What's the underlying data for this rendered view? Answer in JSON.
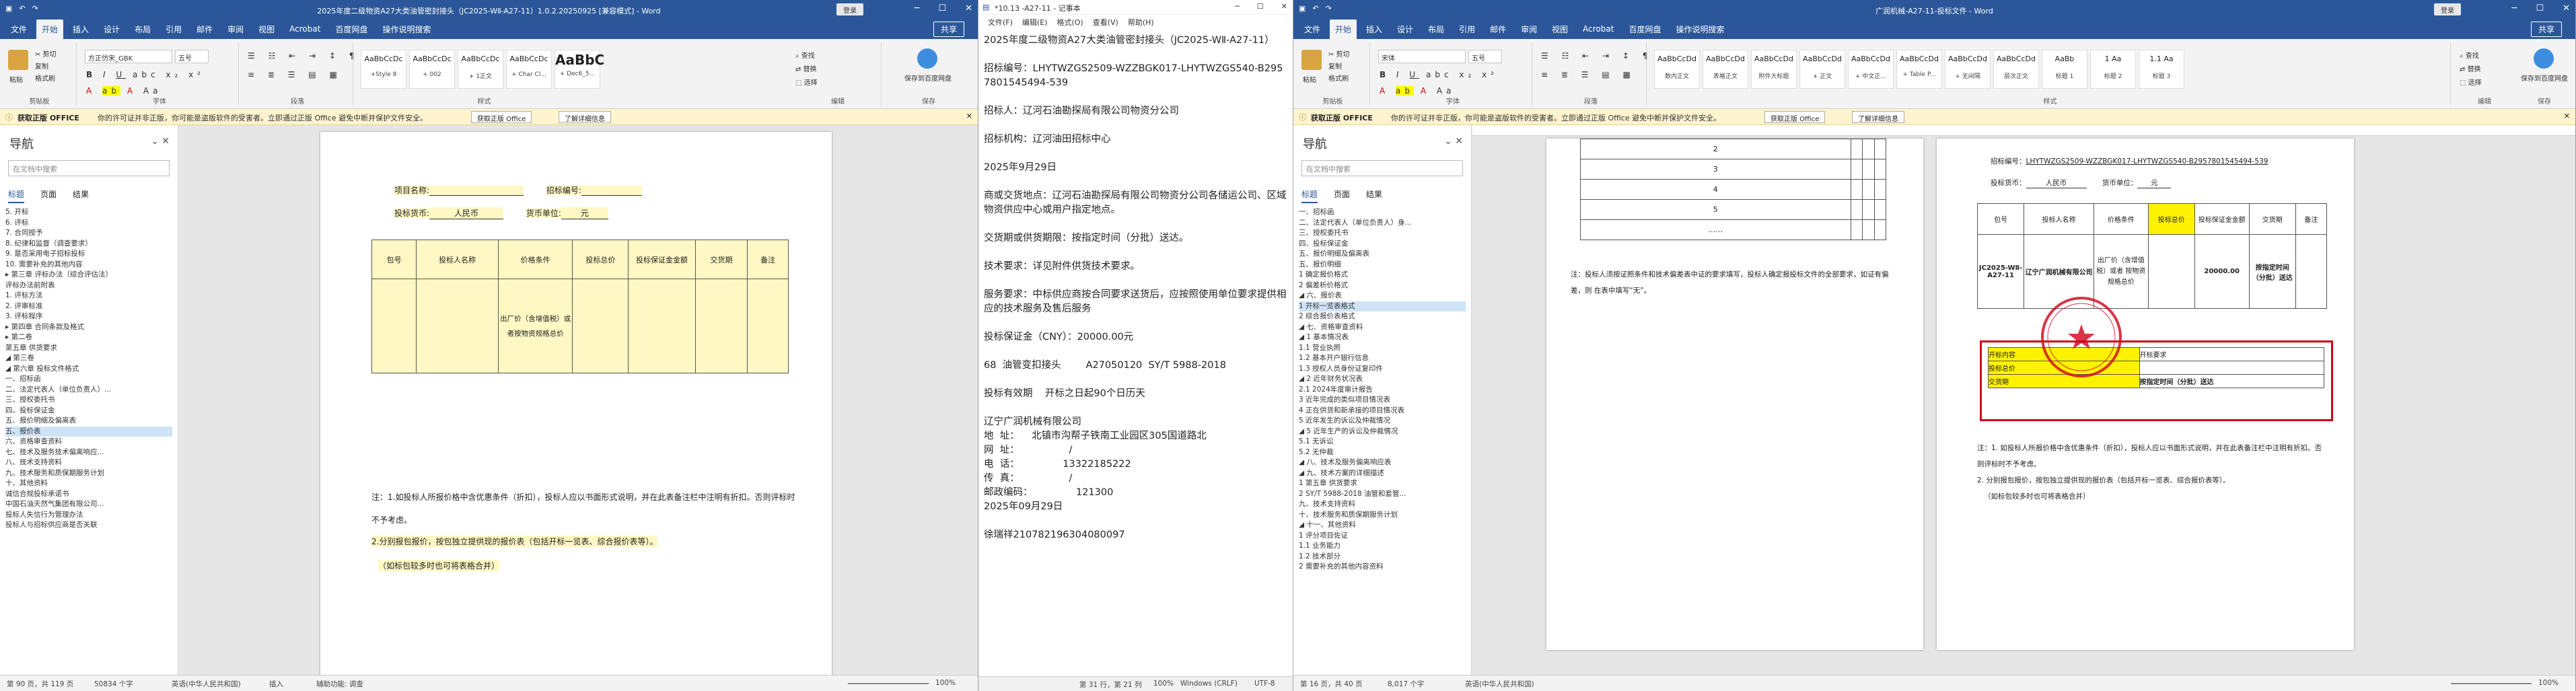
{
  "left_word": {
    "title": "2025年度二级物资A27大类油管密封接头（JC2025-WⅡ-A27-11）1.0.2.20250925 [兼容模式] - Word",
    "signin": "登录",
    "share": "共享",
    "tabs": [
      "文件",
      "开始",
      "插入",
      "设计",
      "布局",
      "引用",
      "邮件",
      "审阅",
      "视图",
      "Acrobat",
      "百度网盘",
      "操作说明搜索"
    ],
    "active_tab": "开始",
    "font_name": "方正仿宋_GBK",
    "font_size": "五号",
    "styles": [
      {
        "preview": "AaBbCcDc",
        "name": "+Style 8"
      },
      {
        "preview": "AaBbCcDc",
        "name": "+ 002"
      },
      {
        "preview": "AaBbCcDc",
        "name": "+ 1正文"
      },
      {
        "preview": "AaBbCcDc",
        "name": "+ Char Cl..."
      },
      {
        "preview": "AaBbC",
        "name": "+ Dec6_5..."
      }
    ],
    "ribbon_groups": [
      "剪贴板",
      "字体",
      "段落",
      "样式",
      "编辑",
      "保存"
    ],
    "clipboard": {
      "paste": "粘贴",
      "cut": "✂ 剪切",
      "copy": "复制",
      "format": "格式刷"
    },
    "editing": {
      "find": "查找",
      "replace": "替换",
      "select": "选择"
    },
    "save_label": "保存到百度网盘",
    "notice": {
      "bold": "获取正版 OFFICE",
      "message": "你的许可证并非正版，你可能是盗版软件的受害者。立即通过正版 Office 避免中断并保护文件安全。",
      "btn1": "获取正版 Office",
      "btn2": "了解详细信息"
    },
    "nav": {
      "title": "导航",
      "search_placeholder": "在文档中搜索",
      "tabs": [
        "标题",
        "页面",
        "结果"
      ],
      "items": [
        "5. 开标",
        "6. 评标",
        "7. 合同授予",
        "8. 纪律和监督（调查要求）",
        "9. 是否采用电子招标投标",
        "10. 需要补充的其他内容",
        "▸ 第三章  评标办法（综合评估法）",
        "评标办法前附表",
        "1. 评标方法",
        "2. 评审标准",
        "3. 评标程序",
        "▸ 第四章  合同条款及格式",
        "▸ 第二卷",
        "第五章 供货要求",
        "◢ 第三卷",
        "◢ 第六章 投标文件格式",
        "一、招标函",
        "二、法定代表人（单位负责人）...",
        "三、授权委托书",
        "四、投标保证金",
        "五、报价明细及偏离表",
        "五、报价表",
        "六、资格审查资料",
        "七、技术及服务技术偏离响应...",
        "八、技术支持资料",
        "九、技术服务和质保期服务计划",
        "十、其他资料",
        "诚信合规投标承诺书",
        "中国石油天然气集团有限公司...",
        "投标人失信行为管理办法",
        "投标人与招标供应商是否关联"
      ],
      "selected_index": 21
    },
    "doc": {
      "label_ttl": "项目名称:",
      "label_bid_no": "招标编号:",
      "label_currency": "投标货币:",
      "currency_value": "人民币",
      "label_unit": "货币单位:",
      "unit_value": "元",
      "table_headers": [
        "包号",
        "投标人名称",
        "价格条件",
        "投标总价",
        "投标保证金金额",
        "交货期",
        "备注"
      ],
      "price_cell": "出厂价（含增值税）或者按物资规格总价",
      "note1": "注：1.如投标人所报价格中含优惠条件（折扣），投标人应以书面形式说明，并在此表备注栏中注明有折扣。否则评标时不予考虑。",
      "note2": "2.分别报包报价，按包独立提供现的报价表（包括开标一览表、综合报价表等）。",
      "note3": "（如标包较多时也可将表格合并）"
    },
    "status": {
      "page": "第 90 页，共 119 页",
      "words": "50834 个字",
      "lang": "英语(中华人民共和国)",
      "insert": "插入",
      "access": "辅助功能: 调查",
      "zoom": "100%"
    }
  },
  "notepad": {
    "title": "*10.13 -A27-11 - 记事本",
    "menu": [
      "文件(F)",
      "编辑(E)",
      "格式(O)",
      "查看(V)",
      "帮助(H)"
    ],
    "lines": [
      "2025年度二级物资A27大类油管密封接头（JC2025-WⅡ-A27-11）",
      "",
      "招标编号：LHYTWZGS2509-WZZBGK017-LHYTWZGS540-B2957801545494-539",
      "",
      "招标人：辽河石油勘探局有限公司物资分公司",
      "",
      "招标机构：辽河油田招标中心",
      "",
      "2025年9月29日",
      "",
      "商或交货地点：辽河石油勘探局有限公司物资分公司各储运公司、区域物资供应中心或用户指定地点。",
      "",
      "交货期或供货期限：按指定时间（分批）送达。",
      "",
      "技术要求：详见附件供货技术要求。",
      "",
      "服务要求：中标供应商按合同要求送货后，应按照使用单位要求提供相应的技术服务及售后服务",
      "",
      "投标保证金（CNY）：20000.00元",
      "",
      "68  油管变扣接头        A27050120  SY/T 5988-2018",
      "",
      "投标有效期    开标之日起90个日历天",
      "",
      "辽宁广润机械有限公司",
      "地  址：    北镇市沟帮子铁南工业园区305国道路北",
      "网  址：                /",
      "电  话：              13322185222",
      "传  真：                /",
      "邮政编码：              121300",
      "2025年09月29日",
      "",
      "徐瑞祥210782196304080097"
    ],
    "status": {
      "pos": "第 31 行，第 21 列",
      "zoom": "100%",
      "eol": "Windows (CRLF)",
      "enc": "UTF-8"
    }
  },
  "right_word": {
    "title": "广润机械-A27-11-投标文件 - Word",
    "signin": "登录",
    "share": "共享",
    "tabs": [
      "文件",
      "开始",
      "插入",
      "设计",
      "布局",
      "引用",
      "邮件",
      "审阅",
      "视图",
      "Acrobat",
      "百度网盘",
      "操作说明搜索"
    ],
    "active_tab": "开始",
    "font_name": "宋体",
    "font_size": "五号",
    "styles": [
      {
        "preview": "AaBbCcDd",
        "name": "数内正文"
      },
      {
        "preview": "AaBbCcDd",
        "name": "表格正文"
      },
      {
        "preview": "AaBbCcDd",
        "name": "附件大标题"
      },
      {
        "preview": "AaBbCcDd",
        "name": "+ 正文"
      },
      {
        "preview": "AaBbCcDd",
        "name": "+ 中文正..."
      },
      {
        "preview": "AaBbCcDd",
        "name": "+ Table P..."
      },
      {
        "preview": "AaBbCcDd",
        "name": "+ 无间隔"
      },
      {
        "preview": "AaBbCcDd",
        "name": "层次正文"
      },
      {
        "preview": "AaBb",
        "name": "标题 1"
      },
      {
        "preview": "1 Aa",
        "name": "标题 2"
      },
      {
        "preview": "1.1 Aa",
        "name": "标题 3"
      }
    ],
    "notice": {
      "bold": "获取正版 OFFICE",
      "message": "你的许可证并非正版，你可能是盗版软件的受害者。立即通过正版 Office 避免中断并保护文件安全。",
      "btn1": "获取正版 Office",
      "btn2": "了解详细信息"
    },
    "nav": {
      "title": "导航",
      "search_placeholder": "在文档中搜索",
      "tabs": [
        "标题",
        "页面",
        "结果"
      ],
      "items": [
        "一、招标函",
        "二、法定代表人（单位负责人）身...",
        "三、授权委托书",
        "四、投标保证金",
        "五、报价明细及偏离表",
        "五、报价明细",
        "1 确定报价格式",
        "2 偏差析价格式",
        "◢ 六、报价表",
        "1 开标一览表格式",
        "2 综合报价表格式",
        "◢ 七、资格审查资料",
        "◢ 1 基本情况表",
        "1.1 营业执照",
        "1.2 基本开户银行信息",
        "1.3 授权人员身份证复印件",
        "◢ 2 近年财务状况表",
        "2.1 2024年度审计报告",
        "3 近年完成的类似项目情况表",
        "4 正在供货和新承接的项目情况表",
        "5 近年发生的诉讼及仲裁情况",
        "◢ 5 近年生产的诉讼及仲裁情况",
        "5.1 无诉讼",
        "5.2 无仲裁",
        "◢ 八、技术及服务偏离响应表",
        "◢ 九、技术方案的详细描述",
        "1 第五章 供货要求",
        "2 SY/T 5988-2018 油管和套管...",
        "九、技术支持资料",
        "十、技术服务和质保期服务计划",
        "◢ 十一、其他资料",
        "1 评分项目佐证",
        "1.1 业务能力",
        "1.2 技术部分",
        "2 需要补充的其他内容资料"
      ],
      "selected_index": 9
    },
    "doc_left": {
      "rows": [
        "2",
        "3",
        "4",
        "5",
        "……"
      ],
      "note": "注：投标人须按证照条件和技术偏差表中证的要求填写，投标人确定报投标文件的全部要求，如证有偏差，则     在表中填写“无”。"
    },
    "doc_right": {
      "bid_no_label": "招标编号：",
      "bid_no": "LHYTWZGS2509-WZZBGK017-LHYTWZGS540-B2957801545494-539",
      "currency_label": "投标货币：",
      "currency": "人民币",
      "unit_label": "货币单位：",
      "unit": "元",
      "headers": [
        "包号",
        "投标人名称",
        "价格条件",
        "投标总价",
        "投标保证金金额",
        "交货期",
        "备注"
      ],
      "row": {
        "pkg": "JC2025-WⅡ-A27-11",
        "bidder": "辽宁广润机械有限公司",
        "price": "出厂价（含增值税）或者 按物资规格总价",
        "deposit": "20000.00",
        "delivery": "按指定时间（分批）送达"
      },
      "box_headers": [
        "开标内容",
        "开标要求"
      ],
      "box_rows": [
        [
          "投标总价",
          ""
        ],
        [
          "交货期",
          "按指定时间（分批）送达"
        ]
      ],
      "seal_text": "辽宁广润机械有限公司",
      "note1": "注：1. 如投标人所报价格中含优惠条件（折扣），投标人应以书面形式说明，并在此表备注栏中注明有折扣。否则评标时不予考虑。",
      "note2": "2. 分别报包报价，按包独立提供现的报价表（包括开标一览表、综合报价表等）。",
      "note3": "（如标包较多时也可将表格合并）"
    },
    "status": {
      "page": "第 16 页，共 40 页",
      "words": "8,017 个字",
      "lang": "英语(中华人民共和国)",
      "zoom": "100%"
    }
  }
}
